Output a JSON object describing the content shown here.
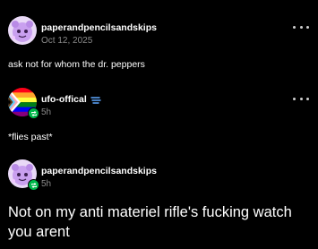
{
  "posts": [
    {
      "username": "paperandpencilsandskips",
      "timestamp": "Oct 12, 2025",
      "body": "ask not for whom the dr. peppers",
      "avatar_icon": "purple-creature-avatar",
      "reblogged": false
    },
    {
      "username": "ufo-offical",
      "timestamp": "5h",
      "body": "*flies past*",
      "avatar_icon": "pride-flag-avatar",
      "badge_icon": "wing-badge-icon",
      "reblogged": true
    },
    {
      "username": "paperandpencilsandskips",
      "timestamp": "5h",
      "body": "Not on my anti materiel rifle's fucking watch you arent",
      "avatar_icon": "purple-creature-avatar",
      "reblogged": true
    }
  ],
  "colors": {
    "background": "#000000",
    "text": "#ffffff",
    "muted": "#8a8a8a",
    "reblog_green": "#00b84a",
    "badge_blue": "#5fa8ff"
  }
}
